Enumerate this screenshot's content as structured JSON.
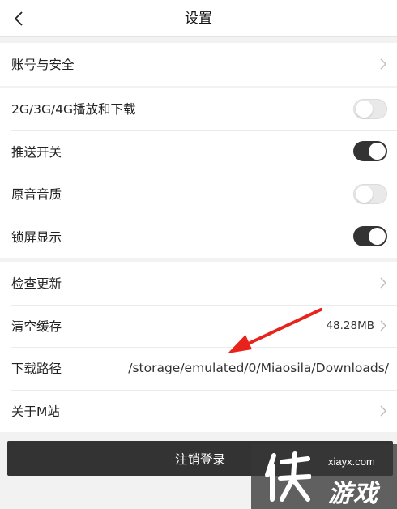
{
  "header": {
    "title": "设置",
    "back_icon": "chevron-left-icon"
  },
  "group_account": {
    "items": [
      {
        "label": "账号与安全",
        "control": "chevron"
      }
    ]
  },
  "group_playback": {
    "items": [
      {
        "label": "2G/3G/4G播放和下载",
        "control": "toggle",
        "on": false
      },
      {
        "label": "推送开关",
        "control": "toggle",
        "on": true
      },
      {
        "label": "原音音质",
        "control": "toggle",
        "on": false
      },
      {
        "label": "锁屏显示",
        "control": "toggle",
        "on": true
      }
    ]
  },
  "group_misc": {
    "items": [
      {
        "label": "检查更新",
        "control": "chevron"
      },
      {
        "label": "清空缓存",
        "control": "chevron",
        "value": "48.28MB"
      },
      {
        "label": "下载路径",
        "value": "/storage/emulated/0/Miaosila/Downloads/"
      },
      {
        "label": "关于M站",
        "control": "chevron"
      }
    ]
  },
  "logout": {
    "label": "注销登录"
  },
  "watermark": {
    "site": "xiayx.com",
    "name": "游戏"
  },
  "colors": {
    "toggle_on": "#333333",
    "toggle_off": "#e9e9e9",
    "button_bg": "#333333",
    "annotation_arrow": "#e8231b"
  }
}
